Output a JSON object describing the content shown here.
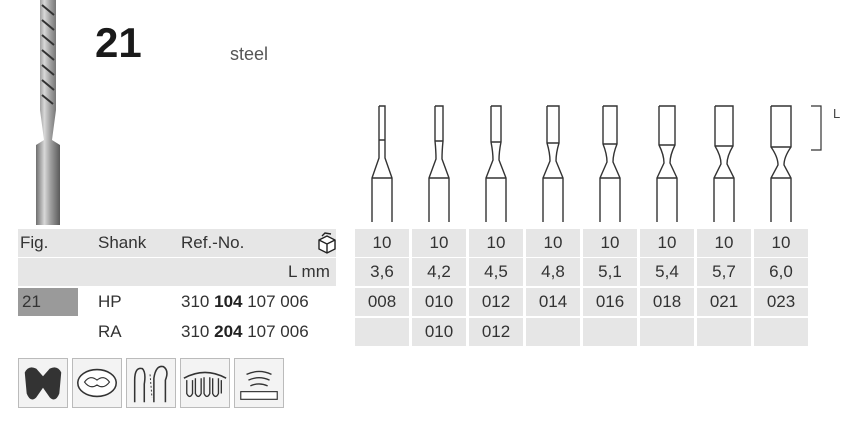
{
  "header": {
    "figure_number": "21",
    "material": "steel",
    "length_marker": "L"
  },
  "table": {
    "headers": {
      "fig": "Fig.",
      "shank": "Shank",
      "ref": "Ref.-No.",
      "package_icon": "package-icon"
    },
    "package_quantities": [
      "10",
      "10",
      "10",
      "10",
      "10",
      "10",
      "10",
      "10"
    ],
    "length_row": {
      "label": "L mm",
      "values": [
        "3,6",
        "4,2",
        "4,5",
        "4,8",
        "5,1",
        "5,4",
        "5,7",
        "6,0"
      ]
    },
    "rows": [
      {
        "fig": "21",
        "shank": "HP",
        "ref_prefix": "310",
        "ref_bold": "104",
        "ref_suffix": "107 006",
        "sizes": [
          "008",
          "010",
          "012",
          "014",
          "016",
          "018",
          "021",
          "023"
        ]
      },
      {
        "fig": "",
        "shank": "RA",
        "ref_prefix": "310",
        "ref_bold": "204",
        "ref_suffix": "107 006",
        "sizes": [
          "",
          "010",
          "012",
          "",
          "",
          "",
          "",
          ""
        ]
      }
    ]
  },
  "application_icons": [
    "molar-cavity-icon",
    "occlusal-preparation-icon",
    "tooth-profile-icon",
    "dental-arch-icon",
    "crown-margin-icon"
  ],
  "colors": {
    "row_gray": "#e6e6e6",
    "fig_dark": "#9a9a9a",
    "steel": "#8f8f8f"
  }
}
